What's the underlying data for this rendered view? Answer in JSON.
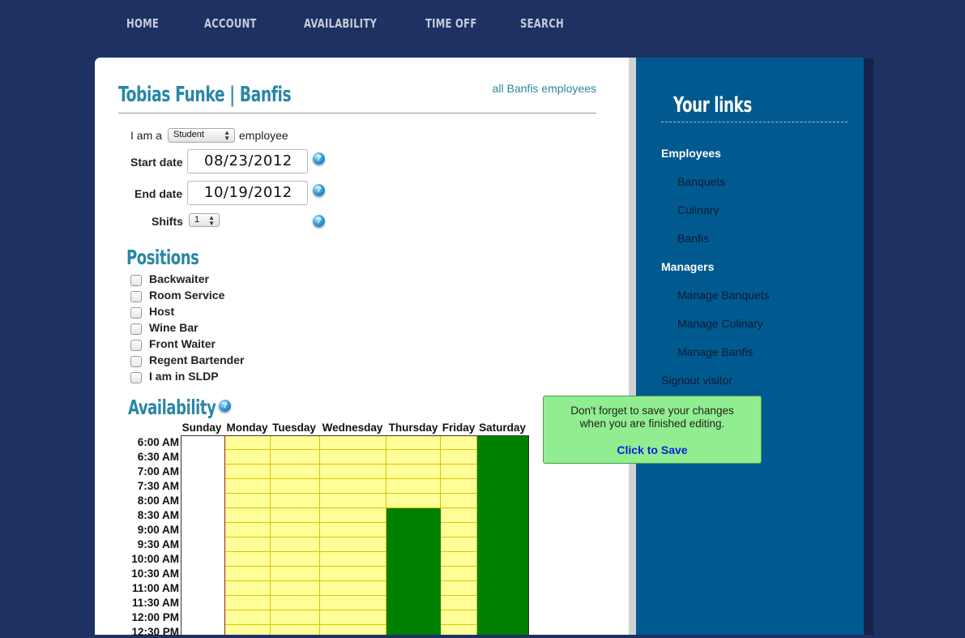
{
  "nav": {
    "items": [
      "HOME",
      "ACCOUNT",
      "AVAILABILITY",
      "TIME OFF",
      "SEARCH"
    ]
  },
  "profile": {
    "title": "Tobias Funke | Banfis",
    "all_link": "all Banfis employees",
    "i_am_a": "I am a",
    "employee_type": "Student",
    "employee_suffix": "employee",
    "start_label": "Start date",
    "start_value": "08/23/2012",
    "end_label": "End date",
    "end_value": "10/19/2012",
    "shifts_label": "Shifts",
    "shifts_value": "1",
    "help_glyph": "?"
  },
  "positions": {
    "heading": "Positions",
    "items": [
      {
        "label": "Backwaiter",
        "checked": false
      },
      {
        "label": "Room Service",
        "checked": false
      },
      {
        "label": "Host",
        "checked": false
      },
      {
        "label": "Wine Bar",
        "checked": false
      },
      {
        "label": "Front Waiter",
        "checked": false
      },
      {
        "label": "Regent Bartender",
        "checked": false
      },
      {
        "label": "I am in SLDP",
        "checked": false
      }
    ]
  },
  "availability": {
    "heading": "Availability",
    "days": [
      "Sunday",
      "Monday",
      "Tuesday",
      "Wednesday",
      "Thursday",
      "Friday",
      "Saturday"
    ],
    "times": [
      "6:00 AM",
      "6:30 AM",
      "7:00 AM",
      "7:30 AM",
      "8:00 AM",
      "8:30 AM",
      "9:00 AM",
      "9:30 AM",
      "10:00 AM",
      "10:30 AM",
      "11:00 AM",
      "11:30 AM",
      "12:00 PM",
      "12:30 PM"
    ],
    "available": {
      "Thursday": [
        "8:30 AM",
        "9:00 AM",
        "9:30 AM",
        "10:00 AM",
        "10:30 AM",
        "11:00 AM",
        "11:30 AM",
        "12:00 PM",
        "12:30 PM"
      ],
      "Saturday": [
        "6:00 AM",
        "6:30 AM",
        "7:00 AM",
        "7:30 AM",
        "8:00 AM",
        "8:30 AM",
        "9:00 AM",
        "9:30 AM",
        "10:00 AM",
        "10:30 AM",
        "11:00 AM",
        "11:30 AM",
        "12:00 PM",
        "12:30 PM"
      ]
    },
    "colors": {
      "available": "#008000",
      "open": "#ffff99",
      "grid_line": "#d9c400",
      "sunday": "#ffffff",
      "border": "#333333"
    }
  },
  "sidebar": {
    "title": "Your links",
    "groups": [
      {
        "heading": "Employees",
        "links": [
          "Banquets",
          "Culinary",
          "Banfis"
        ]
      },
      {
        "heading": "Managers",
        "links": [
          "Manage Banquets",
          "Manage Culinary",
          "Manage Banfis"
        ]
      }
    ],
    "signout": "Signout visitor"
  },
  "toast": {
    "line1": "Don't forget to save your changes",
    "line2": "when you are finished editing.",
    "save": "Click to Save"
  },
  "colors": {
    "page_bg": "#1e3163",
    "sidebar_bg": "#005a8f",
    "accent": "#2a86a8",
    "toast_bg": "#90ee90"
  }
}
